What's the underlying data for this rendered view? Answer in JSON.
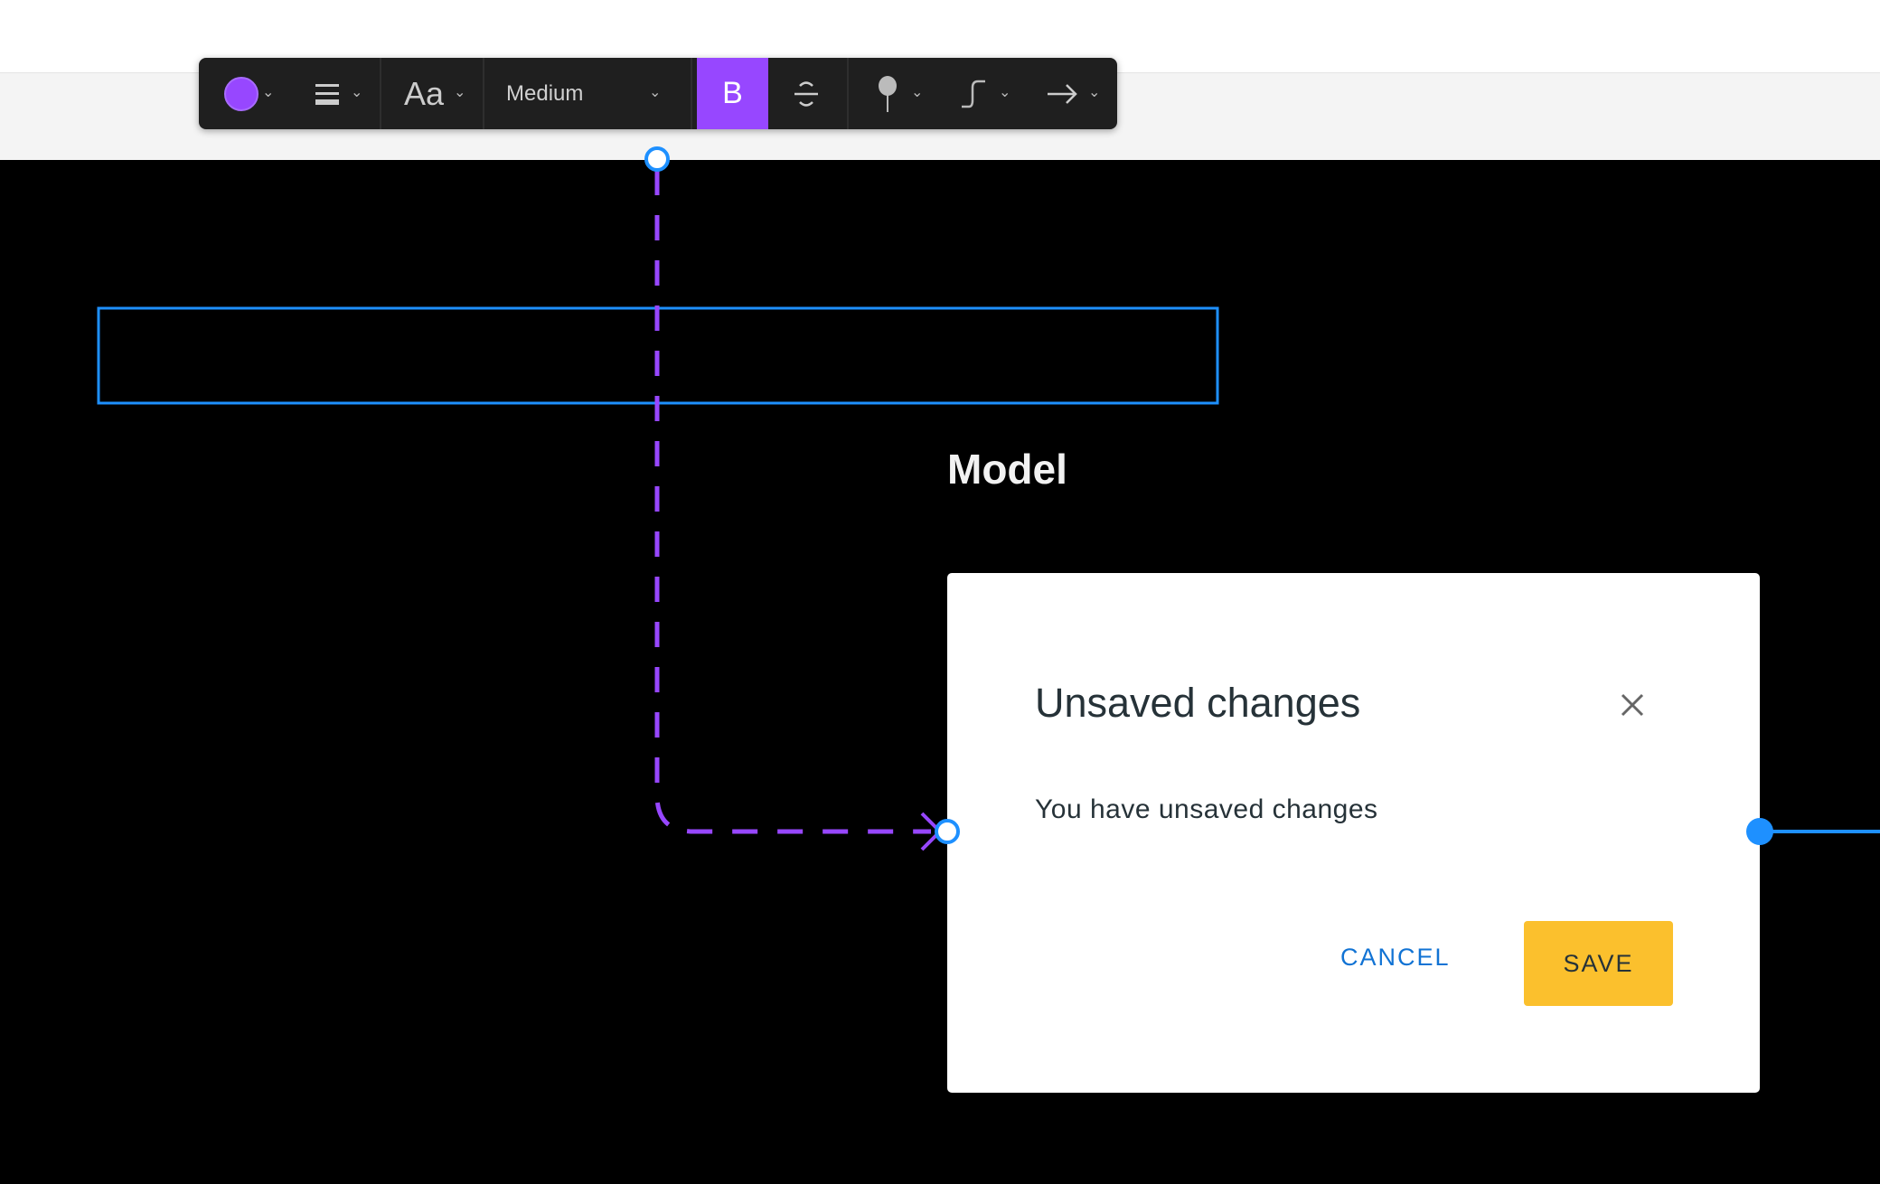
{
  "toolbar": {
    "color_swatch": "#9747ff",
    "align_icon": "align-lines-icon",
    "font_size_label": "Aa",
    "font_weight": "Medium",
    "bold_label": "B",
    "bold_active": true,
    "strike_icon": "strikethrough-icon",
    "pin_icon": "pin-icon",
    "curve_icon": "curve-connector-icon",
    "arrow_icon": "arrow-right-icon"
  },
  "canvas": {
    "label": "Model",
    "connector_color": "#9747ff",
    "selection_color": "#1e90ff"
  },
  "dialog": {
    "title": "Unsaved changes",
    "message": "You have unsaved changes",
    "cancel_label": "CANCEL",
    "save_label": "SAVE",
    "save_color": "#fbc02d",
    "cancel_color": "#1173d4"
  }
}
